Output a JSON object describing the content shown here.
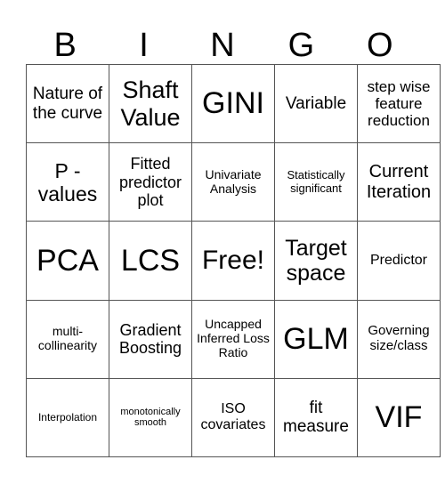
{
  "header": {
    "letters": [
      "B",
      "I",
      "N",
      "G",
      "O"
    ]
  },
  "grid": {
    "rows": [
      [
        {
          "text": "Nature of the curve",
          "size": 19
        },
        {
          "text": "Shaft Value",
          "size": 27
        },
        {
          "text": "GINI",
          "size": 34
        },
        {
          "text": "Variable",
          "size": 19
        },
        {
          "text": "step wise feature reduction",
          "size": 17
        }
      ],
      [
        {
          "text": "P - values",
          "size": 23
        },
        {
          "text": "Fitted predictor plot",
          "size": 18
        },
        {
          "text": "Univariate Analysis",
          "size": 14
        },
        {
          "text": "Statistically significant",
          "size": 13
        },
        {
          "text": "Current Iteration",
          "size": 20
        }
      ],
      [
        {
          "text": "PCA",
          "size": 34
        },
        {
          "text": "LCS",
          "size": 34
        },
        {
          "text": "Free!",
          "size": 30
        },
        {
          "text": "Target space",
          "size": 25
        },
        {
          "text": "Predictor",
          "size": 16
        }
      ],
      [
        {
          "text": "multi-collinearity",
          "size": 14
        },
        {
          "text": "Gradient Boosting",
          "size": 18
        },
        {
          "text": "Uncapped Inferred Loss Ratio",
          "size": 14
        },
        {
          "text": "GLM",
          "size": 34
        },
        {
          "text": "Governing size/class",
          "size": 15
        }
      ],
      [
        {
          "text": "Interpolation",
          "size": 12
        },
        {
          "text": "monotonically smooth",
          "size": 11
        },
        {
          "text": "ISO covariates",
          "size": 16
        },
        {
          "text": "fit measure",
          "size": 19
        },
        {
          "text": "VIF",
          "size": 34
        }
      ]
    ]
  }
}
